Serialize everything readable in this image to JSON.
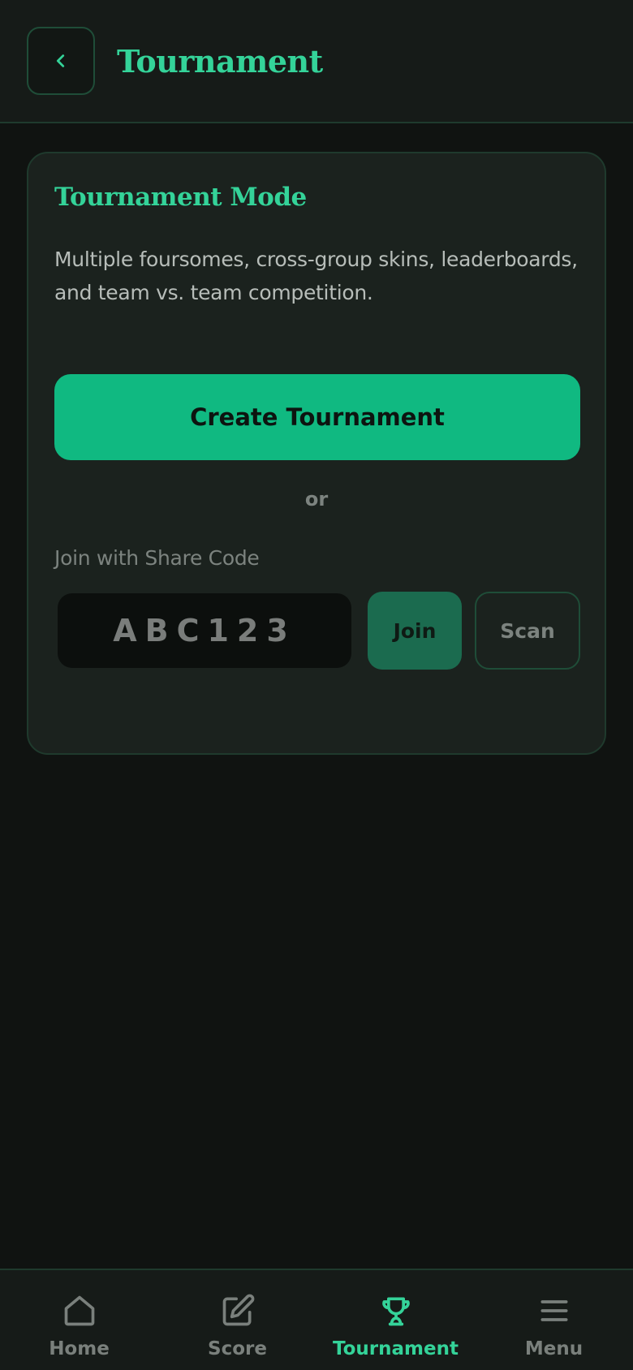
{
  "header": {
    "title": "Tournament",
    "back_icon": "chevron-left-icon"
  },
  "card": {
    "title": "Tournament Mode",
    "description": "Multiple foursomes, cross-group skins, leaderboards, and team vs. team competition.",
    "create_button_label": "Create Tournament",
    "or_label": "or",
    "join_label": "Join with Share Code",
    "share_code_placeholder": "ABC123",
    "join_button_label": "Join",
    "scan_button_label": "Scan"
  },
  "bottom_nav": {
    "items": [
      {
        "label": "Home",
        "icon": "home-icon",
        "active": false
      },
      {
        "label": "Score",
        "icon": "edit-icon",
        "active": false
      },
      {
        "label": "Tournament",
        "icon": "trophy-icon",
        "active": true
      },
      {
        "label": "Menu",
        "icon": "menu-icon",
        "active": false
      }
    ]
  },
  "colors": {
    "background": "#101311",
    "surface": "#1b221e",
    "accent": "#34d399",
    "primary_button": "#10b981",
    "muted_text": "#7c837f"
  }
}
